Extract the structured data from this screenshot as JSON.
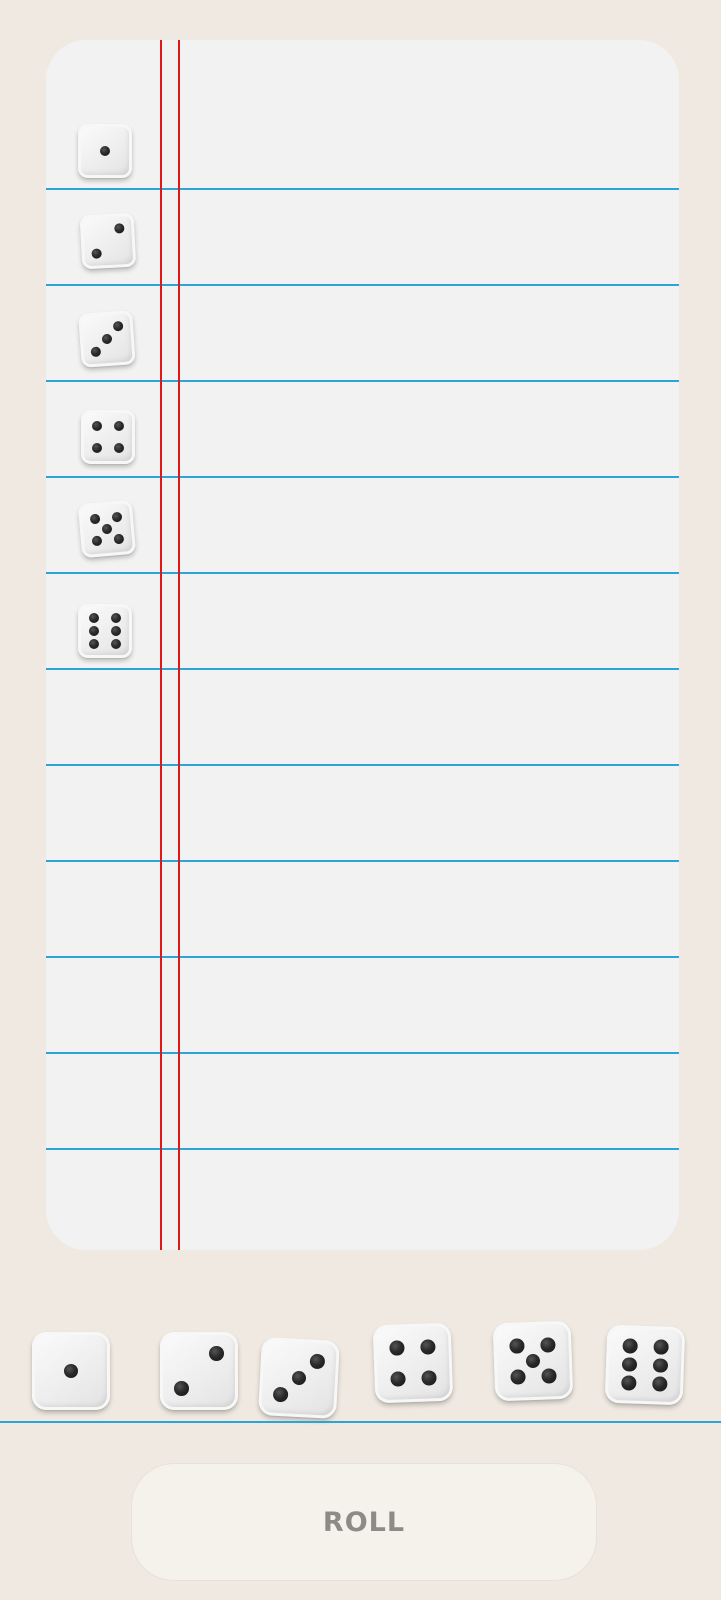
{
  "colors": {
    "background": "#efe9e1",
    "sheet": "#f2f2f2",
    "ruled_line": "#2aa5d6",
    "margin_line": "#e01818",
    "pip": "#222222",
    "button": "#f5f2ec",
    "button_text": "#8e8a85"
  },
  "score_sheet": {
    "row_dice": [
      1,
      2,
      3,
      4,
      5,
      6
    ],
    "empty_rows": 6
  },
  "rolled_dice": [
    1,
    2,
    3,
    4,
    5,
    6
  ],
  "roll_button": {
    "label": "ROLL"
  }
}
